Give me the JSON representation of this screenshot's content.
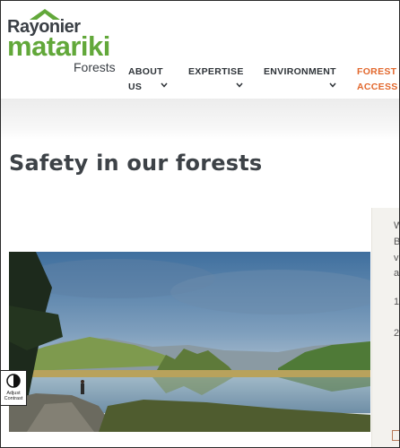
{
  "logo": {
    "brand_top": "Rayonier",
    "brand_main": "matariki",
    "brand_sub": "Forests",
    "colors": {
      "green": "#62a83a",
      "dark": "#3a3f45"
    }
  },
  "nav": {
    "items": [
      {
        "line1": "ABOUT",
        "line2": "US",
        "icon": "chevron-down-icon"
      },
      {
        "line1": "EXPERTISE",
        "line2": "",
        "icon": "chevron-down-icon"
      },
      {
        "line1": "ENVIRONMENT",
        "line2": "",
        "icon": "chevron-down-icon"
      },
      {
        "line1": "FOREST",
        "line2": "ACCESS",
        "icon": ""
      }
    ],
    "accent_color": "#e2682d"
  },
  "page": {
    "title": "Safety in our forests"
  },
  "side_panel": {
    "fragments": [
      "W",
      "B",
      "vi",
      "a",
      "1",
      "2"
    ]
  },
  "accessibility": {
    "contrast_label_1": "Adjust",
    "contrast_label_2": "Contrast",
    "icon": "contrast-icon"
  }
}
